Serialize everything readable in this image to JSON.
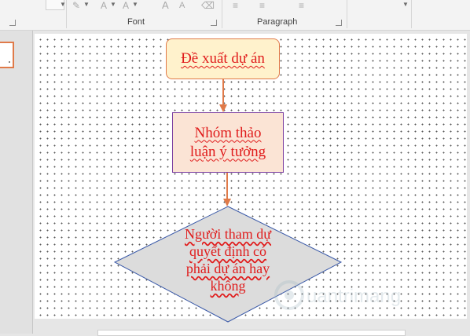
{
  "ribbon": {
    "groups": [
      {
        "label": "Font"
      },
      {
        "label": "Paragraph"
      }
    ],
    "font_glyphs": [
      "A",
      "A"
    ],
    "grow_glyph": "A",
    "shrink_glyph": "A",
    "launcher_icon": "dialog-launcher-icon"
  },
  "flowchart": {
    "step1": "Đề xuất dự án",
    "step2": "Nhóm thảo luận ý tưởng",
    "step3_lines": [
      "Người tham dự",
      "quyết định có",
      "phải dự án hay",
      "không"
    ]
  },
  "watermark": {
    "text": "uantrimang"
  },
  "colors": {
    "text_red": "#e01b1b",
    "connector_orange": "#e07a49",
    "proposal_fill": "#fff2cc",
    "discuss_fill": "#fbe4d5",
    "decision_fill": "#dcdcdc"
  }
}
